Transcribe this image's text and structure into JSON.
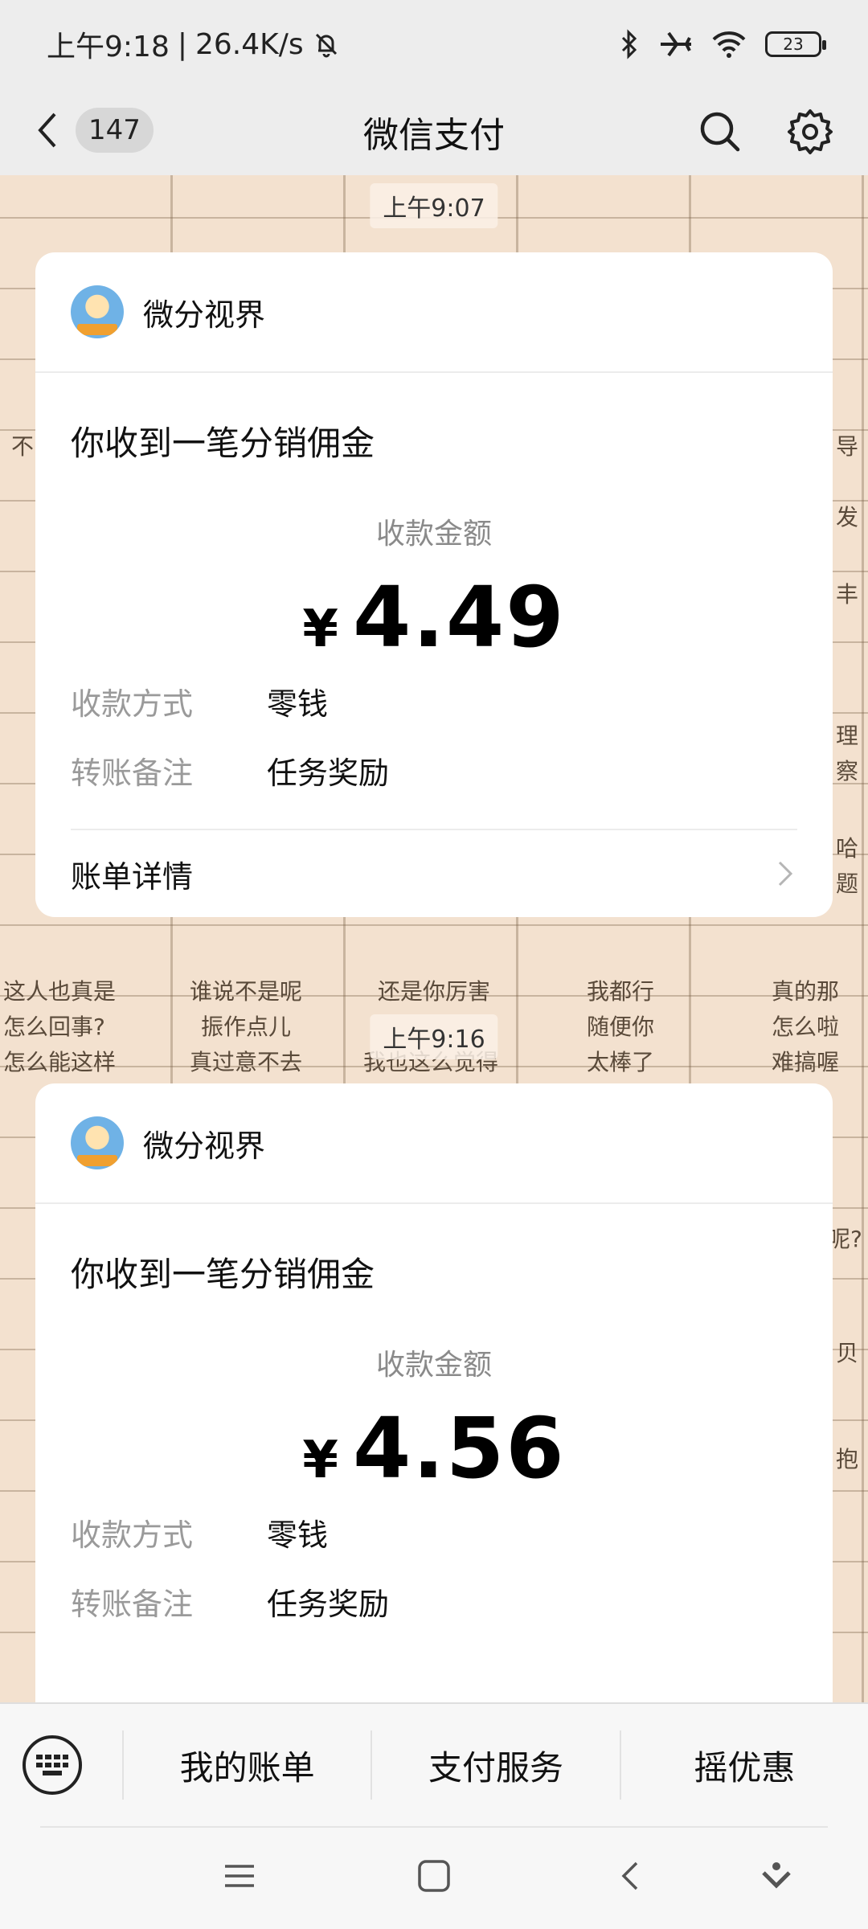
{
  "status_bar": {
    "time": "上午9:18",
    "speed": "26.4K/s",
    "battery": "23"
  },
  "nav": {
    "back_count": "147",
    "title": "微信支付"
  },
  "chat_background_words": [
    "不",
    "导",
    "发",
    "丰",
    "理",
    "察",
    "哈",
    "题",
    "这人也真是",
    "谁说不是呢",
    "还是你厉害",
    "我都行",
    "真的那",
    "怎么回事?",
    "振作点儿",
    "随便你",
    "怎么啦",
    "怎么能这样",
    "真过意不去",
    "我也这么觉得",
    "太棒了",
    "难搞喔",
    "呢?",
    "贝",
    "抱"
  ],
  "messages": [
    {
      "time": "上午9:07",
      "merchant": "微分视界",
      "title": "你收到一笔分销佣金",
      "amount_label": "收款金额",
      "currency": "¥",
      "amount": "4.49",
      "method_label": "收款方式",
      "method_value": "零钱",
      "note_label": "转账备注",
      "note_value": "任务奖励",
      "footer": "账单详情"
    },
    {
      "time": "上午9:16",
      "merchant": "微分视界",
      "title": "你收到一笔分销佣金",
      "amount_label": "收款金额",
      "currency": "¥",
      "amount": "4.56",
      "method_label": "收款方式",
      "method_value": "零钱",
      "note_label": "转账备注",
      "note_value": "任务奖励"
    }
  ],
  "bottom_menu": {
    "items": [
      "我的账单",
      "支付服务",
      "摇优惠"
    ]
  },
  "colors": {
    "background": "#ededed",
    "chat_bg": "#f3e1cf",
    "card": "#ffffff",
    "muted_text": "#8a8a8a"
  }
}
